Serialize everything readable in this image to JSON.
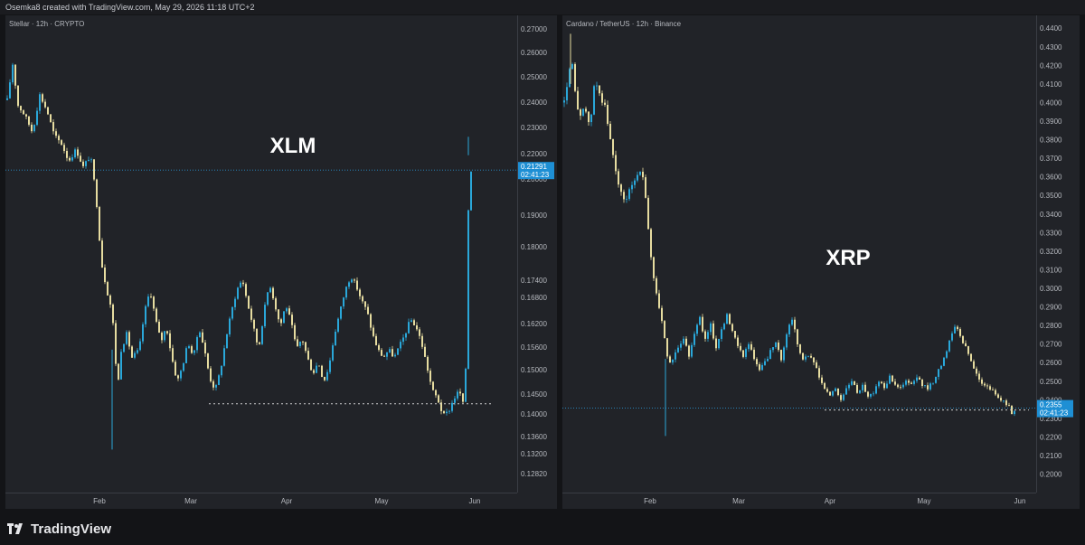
{
  "header": {
    "credit": "Osemka8 created with TradingView.com, May 29, 2026 11:18 UTC+2"
  },
  "footer": {
    "brand": "TradingView"
  },
  "colors": {
    "up": "#2aa7d9",
    "down": "#e6dca0",
    "price_tag": "#1e8fd4",
    "grid_dotted": "#cfcfcf"
  },
  "chart_data": [
    {
      "type": "candlestick",
      "symbol_label": "Stellar · 12h · CRYPTO",
      "annotation": "XLM",
      "y_ticks": [
        "0.27000",
        "0.26000",
        "0.25000",
        "0.24000",
        "0.23000",
        "0.22000",
        "0.20000",
        "0.19000",
        "0.18000",
        "0.17400",
        "0.16800",
        "0.16200",
        "0.15600",
        "0.15000",
        "0.14500",
        "0.14000",
        "0.13600",
        "0.13200",
        "0.12820"
      ],
      "x_ticks": [
        "Feb",
        "Mar",
        "Apr",
        "May",
        "Jun"
      ],
      "last_price": "0.21291",
      "countdown": "02:41:23",
      "support_level": 0.1468,
      "close_path": [
        [
          0,
          0.238
        ],
        [
          6,
          0.252
        ],
        [
          12,
          0.236
        ],
        [
          20,
          0.232
        ],
        [
          28,
          0.226
        ],
        [
          36,
          0.24
        ],
        [
          44,
          0.234
        ],
        [
          52,
          0.225
        ],
        [
          60,
          0.222
        ],
        [
          68,
          0.216
        ],
        [
          76,
          0.22
        ],
        [
          84,
          0.214
        ],
        [
          92,
          0.218
        ],
        [
          98,
          0.205
        ],
        [
          104,
          0.184
        ],
        [
          110,
          0.176
        ],
        [
          116,
          0.17
        ],
        [
          122,
          0.15
        ],
        [
          126,
          0.16
        ],
        [
          132,
          0.164
        ],
        [
          138,
          0.158
        ],
        [
          146,
          0.16
        ],
        [
          152,
          0.17
        ],
        [
          158,
          0.176
        ],
        [
          164,
          0.168
        ],
        [
          170,
          0.162
        ],
        [
          176,
          0.166
        ],
        [
          182,
          0.158
        ],
        [
          188,
          0.152
        ],
        [
          194,
          0.156
        ],
        [
          200,
          0.162
        ],
        [
          206,
          0.158
        ],
        [
          212,
          0.166
        ],
        [
          218,
          0.16
        ],
        [
          224,
          0.153
        ],
        [
          230,
          0.15
        ],
        [
          236,
          0.155
        ],
        [
          242,
          0.163
        ],
        [
          248,
          0.17
        ],
        [
          254,
          0.176
        ],
        [
          260,
          0.179
        ],
        [
          266,
          0.172
        ],
        [
          272,
          0.166
        ],
        [
          278,
          0.16
        ],
        [
          284,
          0.17
        ],
        [
          290,
          0.178
        ],
        [
          296,
          0.172
        ],
        [
          302,
          0.166
        ],
        [
          308,
          0.172
        ],
        [
          314,
          0.167
        ],
        [
          320,
          0.16
        ],
        [
          326,
          0.163
        ],
        [
          332,
          0.158
        ],
        [
          338,
          0.154
        ],
        [
          344,
          0.157
        ],
        [
          350,
          0.152
        ],
        [
          356,
          0.156
        ],
        [
          362,
          0.164
        ],
        [
          368,
          0.17
        ],
        [
          374,
          0.176
        ],
        [
          380,
          0.18
        ],
        [
          386,
          0.177
        ],
        [
          392,
          0.173
        ],
        [
          398,
          0.17
        ],
        [
          404,
          0.164
        ],
        [
          410,
          0.16
        ],
        [
          416,
          0.158
        ],
        [
          422,
          0.16
        ],
        [
          428,
          0.158
        ],
        [
          434,
          0.161
        ],
        [
          440,
          0.164
        ],
        [
          446,
          0.168
        ],
        [
          452,
          0.166
        ],
        [
          458,
          0.162
        ],
        [
          464,
          0.156
        ],
        [
          470,
          0.15
        ],
        [
          476,
          0.148
        ],
        [
          482,
          0.144
        ],
        [
          488,
          0.145
        ],
        [
          494,
          0.148
        ],
        [
          500,
          0.15
        ],
        [
          505,
          0.146
        ],
        [
          508,
          0.16
        ],
        [
          510,
          0.2
        ],
        [
          513,
          0.213
        ]
      ]
    },
    {
      "type": "candlestick",
      "symbol_label": "Cardano / TetherUS · 12h · Binance",
      "annotation": "XRP",
      "y_ticks": [
        "0.4400",
        "0.4300",
        "0.4200",
        "0.4100",
        "0.4000",
        "0.3900",
        "0.3800",
        "0.3700",
        "0.3600",
        "0.3500",
        "0.3400",
        "0.3300",
        "0.3200",
        "0.3100",
        "0.3000",
        "0.2900",
        "0.2800",
        "0.2700",
        "0.2600",
        "0.2500",
        "0.2400",
        "0.2300",
        "0.2200",
        "0.2100",
        "0.2000"
      ],
      "x_ticks": [
        "Feb",
        "Mar",
        "Apr",
        "May",
        "Jun"
      ],
      "last_price": "0.2355",
      "countdown": "02:41:23",
      "support_level": 0.2345,
      "close_path": [
        [
          0,
          0.4
        ],
        [
          4,
          0.412
        ],
        [
          8,
          0.424
        ],
        [
          12,
          0.405
        ],
        [
          16,
          0.392
        ],
        [
          22,
          0.398
        ],
        [
          28,
          0.386
        ],
        [
          34,
          0.412
        ],
        [
          40,
          0.404
        ],
        [
          46,
          0.396
        ],
        [
          50,
          0.382
        ],
        [
          56,
          0.366
        ],
        [
          62,
          0.352
        ],
        [
          68,
          0.346
        ],
        [
          74,
          0.356
        ],
        [
          80,
          0.36
        ],
        [
          86,
          0.364
        ],
        [
          90,
          0.348
        ],
        [
          94,
          0.325
        ],
        [
          100,
          0.302
        ],
        [
          106,
          0.288
        ],
        [
          112,
          0.27
        ],
        [
          116,
          0.258
        ],
        [
          120,
          0.262
        ],
        [
          126,
          0.268
        ],
        [
          132,
          0.274
        ],
        [
          138,
          0.264
        ],
        [
          144,
          0.276
        ],
        [
          150,
          0.284
        ],
        [
          156,
          0.272
        ],
        [
          162,
          0.28
        ],
        [
          168,
          0.268
        ],
        [
          174,
          0.278
        ],
        [
          180,
          0.286
        ],
        [
          186,
          0.276
        ],
        [
          192,
          0.27
        ],
        [
          198,
          0.264
        ],
        [
          204,
          0.27
        ],
        [
          210,
          0.262
        ],
        [
          216,
          0.256
        ],
        [
          222,
          0.26
        ],
        [
          228,
          0.266
        ],
        [
          234,
          0.27
        ],
        [
          240,
          0.262
        ],
        [
          246,
          0.276
        ],
        [
          252,
          0.284
        ],
        [
          258,
          0.27
        ],
        [
          264,
          0.262
        ],
        [
          270,
          0.264
        ],
        [
          276,
          0.26
        ],
        [
          282,
          0.252
        ],
        [
          288,
          0.246
        ],
        [
          294,
          0.242
        ],
        [
          300,
          0.246
        ],
        [
          306,
          0.24
        ],
        [
          312,
          0.246
        ],
        [
          318,
          0.25
        ],
        [
          324,
          0.244
        ],
        [
          330,
          0.248
        ],
        [
          336,
          0.242
        ],
        [
          342,
          0.244
        ],
        [
          348,
          0.25
        ],
        [
          354,
          0.247
        ],
        [
          360,
          0.252
        ],
        [
          366,
          0.249
        ],
        [
          372,
          0.246
        ],
        [
          378,
          0.25
        ],
        [
          384,
          0.248
        ],
        [
          390,
          0.252
        ],
        [
          396,
          0.248
        ],
        [
          402,
          0.246
        ],
        [
          408,
          0.25
        ],
        [
          414,
          0.256
        ],
        [
          420,
          0.262
        ],
        [
          426,
          0.272
        ],
        [
          432,
          0.28
        ],
        [
          436,
          0.278
        ],
        [
          440,
          0.272
        ],
        [
          446,
          0.266
        ],
        [
          452,
          0.258
        ],
        [
          458,
          0.252
        ],
        [
          464,
          0.248
        ],
        [
          470,
          0.246
        ],
        [
          476,
          0.244
        ],
        [
          482,
          0.24
        ],
        [
          488,
          0.238
        ],
        [
          492,
          0.236
        ],
        [
          496,
          0.232
        ],
        [
          500,
          0.236
        ]
      ]
    }
  ]
}
